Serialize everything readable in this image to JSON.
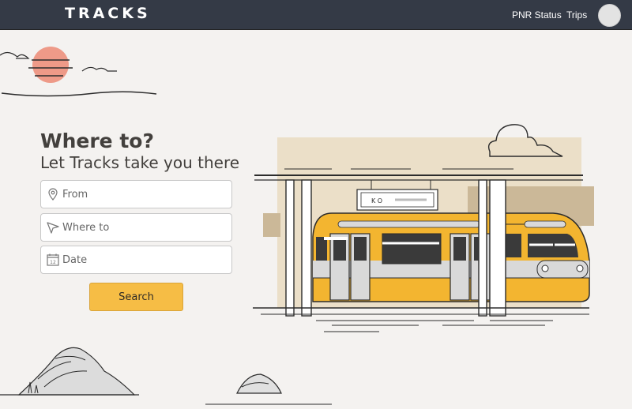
{
  "header": {
    "logo_text": "TRACKS",
    "links": [
      "PNR Status",
      "Trips"
    ]
  },
  "hero": {
    "title": "Where to?",
    "subtitle": "Let Tracks take you there"
  },
  "form": {
    "from_placeholder": "From",
    "to_placeholder": "Where to",
    "date_placeholder": "Date",
    "date_icon_text": "12",
    "search_label": "Search"
  },
  "illustration": {
    "station_sign_text": "K O"
  },
  "colors": {
    "navbar": "#343a46",
    "accent": "#f6bd45",
    "background": "#f4f2f0",
    "train_yellow": "#f3b530",
    "sun": "#ee9a88"
  },
  "icons": [
    "location-pin-icon",
    "navigation-arrow-icon",
    "calendar-icon"
  ]
}
